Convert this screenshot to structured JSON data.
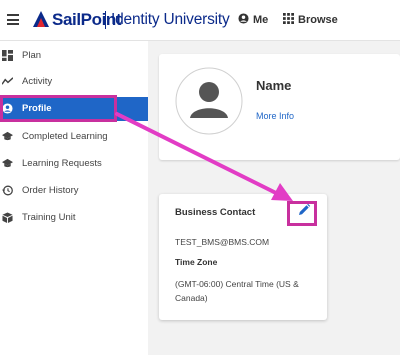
{
  "header": {
    "logo": "SailPoint",
    "subtitle": "Identity University",
    "nav": {
      "me": "Me",
      "browse": "Browse"
    }
  },
  "sidebar": {
    "items": [
      {
        "label": "Plan",
        "icon": "dashboard-icon"
      },
      {
        "label": "Activity",
        "icon": "activity-icon"
      },
      {
        "label": "Profile",
        "icon": "user-circle-icon",
        "active": true
      },
      {
        "label": "Completed Learning",
        "icon": "graduation-cap-icon"
      },
      {
        "label": "Learning Requests",
        "icon": "graduation-cap-icon"
      },
      {
        "label": "Order History",
        "icon": "history-icon"
      },
      {
        "label": "Training Unit",
        "icon": "cube-icon"
      }
    ]
  },
  "profile": {
    "name": "Name",
    "more_info": "More Info"
  },
  "contact": {
    "title": "Business Contact",
    "email": "TEST_BMS@BMS.COM",
    "timezone_label": "Time Zone",
    "timezone_value": "(GMT-06:00) Central Time (US & Canada)"
  },
  "colors": {
    "accent": "#1f66c7",
    "brand": "#0b2a8a",
    "annotation": "#c8309e"
  }
}
